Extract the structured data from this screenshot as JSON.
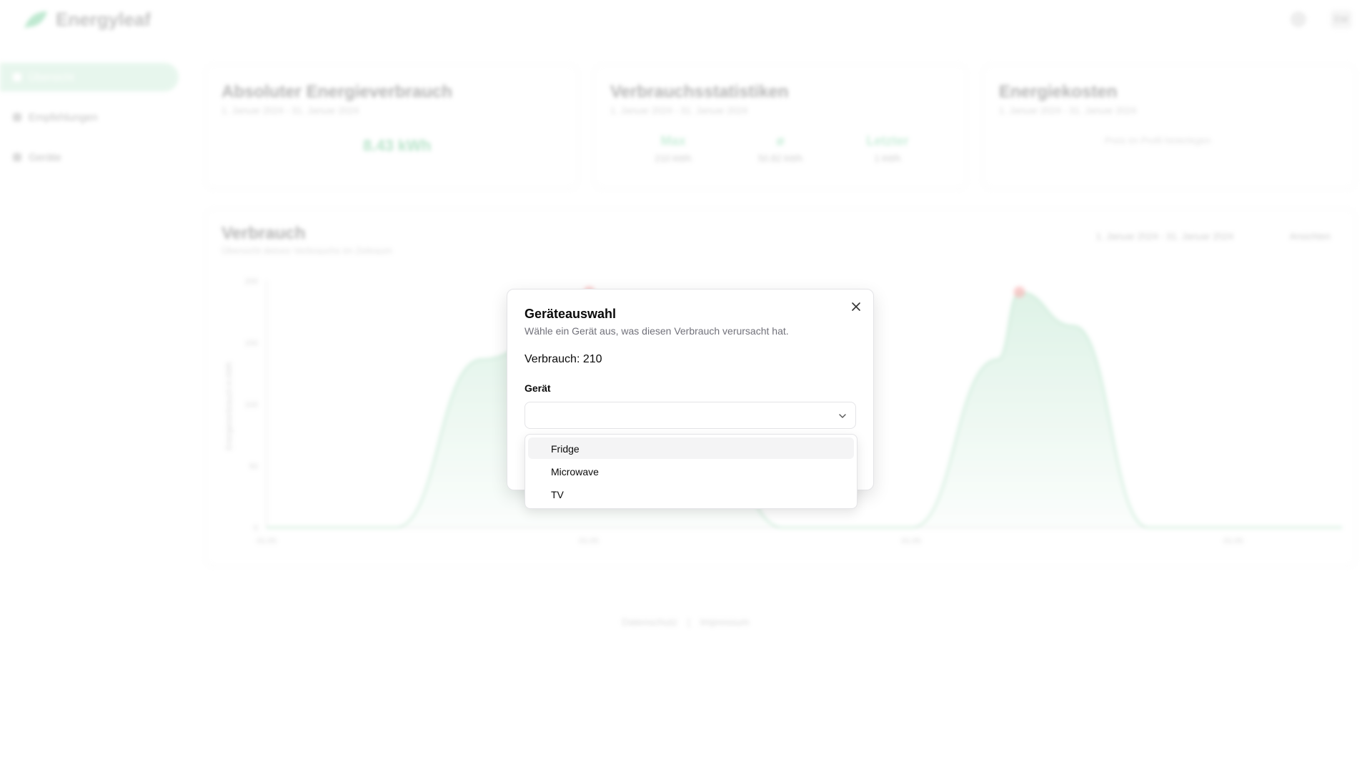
{
  "app": {
    "brand": "Energyleaf",
    "user_initials": "EW"
  },
  "sidebar": {
    "items": [
      {
        "label": "Übersicht",
        "icon": "home-icon"
      },
      {
        "label": "Empfehlungen",
        "icon": "lightbulb-icon"
      },
      {
        "label": "Geräte",
        "icon": "devices-icon"
      }
    ]
  },
  "cards": {
    "absolute": {
      "title": "Absoluter Energieverbrauch",
      "subtitle": "1. Januar 2024 - 31. Januar 2024",
      "value": "8.43 kWh"
    },
    "stats": {
      "title": "Verbrauchsstatistiken",
      "subtitle": "1. Januar 2024 - 31. Januar 2024",
      "items": [
        {
          "label": "Max",
          "value": "210 kWh"
        },
        {
          "label": "ø",
          "value": "50.82 kWh"
        },
        {
          "label": "Letzter",
          "value": "1 kWh"
        }
      ]
    },
    "costs": {
      "title": "Energiekosten",
      "subtitle": "1. Januar 2024 - 31. Januar 2024",
      "hint": "Preis im Profil hinterlegen"
    }
  },
  "consumption_chart": {
    "title": "Verbrauch",
    "subtitle": "Übersicht deines Verbrauchs im Zeitraum",
    "date_range": "1. Januar 2024 - 31. Januar 2024",
    "view_button": "Ansichten",
    "colors": {
      "area": "#37b46b",
      "peak": "#ef4444"
    }
  },
  "chart_data": {
    "type": "area",
    "title": "Verbrauch",
    "x": [
      0,
      0.12,
      0.2,
      0.3,
      0.4,
      0.48,
      0.55,
      0.6,
      0.68,
      0.7,
      0.75,
      0.82,
      0.88,
      1.0
    ],
    "y": [
      0,
      0,
      150,
      210,
      120,
      0,
      0,
      0,
      150,
      210,
      180,
      0,
      0,
      0
    ],
    "peaks": [
      {
        "x": 0.3,
        "y": 210
      },
      {
        "x": 0.7,
        "y": 210
      }
    ],
    "ylim": [
      0,
      220
    ],
    "ylabel": "Energieverbrauch in kWh",
    "yticks": [
      "200",
      "150",
      "100",
      "50",
      "0"
    ],
    "xticks": [
      "01:00",
      "01:00",
      "01:00",
      "01:00"
    ]
  },
  "footer": {
    "links": [
      "Datenschutz",
      "Impressum"
    ]
  },
  "dialog": {
    "title": "Geräteauswahl",
    "description": "Wähle ein Gerät aus, was diesen Verbrauch verursacht hat.",
    "consumption_text": "Verbrauch: 210",
    "device_label": "Gerät",
    "select_value": "",
    "options": [
      "Fridge",
      "Microwave",
      "TV"
    ],
    "highlighted_option": "Fridge"
  }
}
